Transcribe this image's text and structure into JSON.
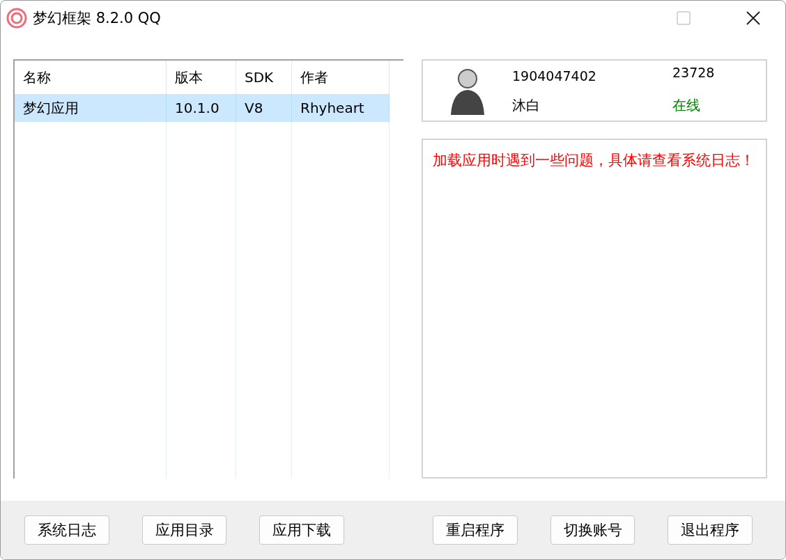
{
  "window": {
    "title": "梦幻框架 8.2.0 QQ"
  },
  "table": {
    "columns": [
      "名称",
      "版本",
      "SDK",
      "作者"
    ],
    "rows": [
      {
        "cells": [
          "梦幻应用",
          "10.1.0",
          "V8",
          "Rhyheart"
        ],
        "selected": true
      }
    ]
  },
  "account": {
    "qq": "1904047402",
    "nickname": "沐白",
    "number": "23728",
    "status": "在线"
  },
  "message": "加载应用时遇到一些问题，具体请查看系统日志！",
  "buttons": [
    "系统日志",
    "应用目录",
    "应用下载",
    "重启程序",
    "切换账号",
    "退出程序"
  ]
}
